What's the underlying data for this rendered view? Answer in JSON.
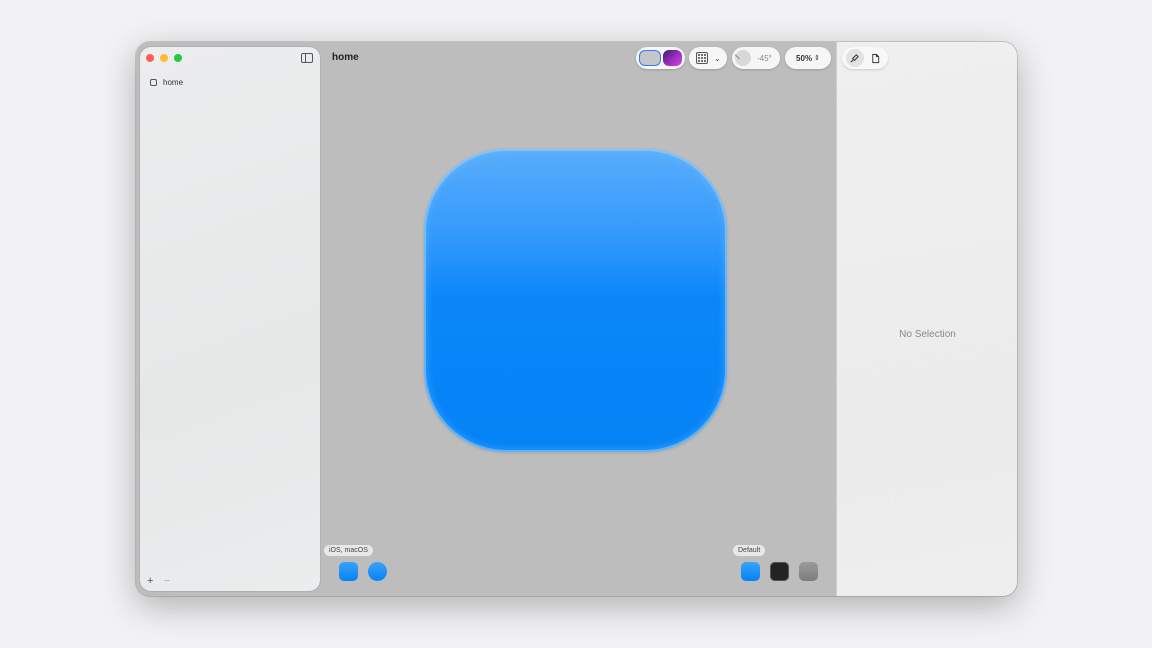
{
  "sidebar": {
    "files": [
      {
        "label": "home",
        "icon": "file-square-icon"
      }
    ],
    "add_label": "+",
    "remove_label": "−"
  },
  "canvas": {
    "title": "home",
    "toolbar": {
      "angle_value": "-45°",
      "zoom_value": "50%"
    },
    "platform_group_label": "iOS, macOS",
    "variant_group_label": "Default",
    "icon_colors": {
      "top": "#4ba6fb",
      "bottom": "#0583f6"
    }
  },
  "inspector": {
    "tabs": [
      {
        "icon": "brush-icon",
        "active": true
      },
      {
        "icon": "document-icon",
        "active": false
      }
    ],
    "empty_label": "No Selection"
  },
  "colors": {
    "accent": "#2f7ff0",
    "canvas_background": "#bdbdbd"
  }
}
